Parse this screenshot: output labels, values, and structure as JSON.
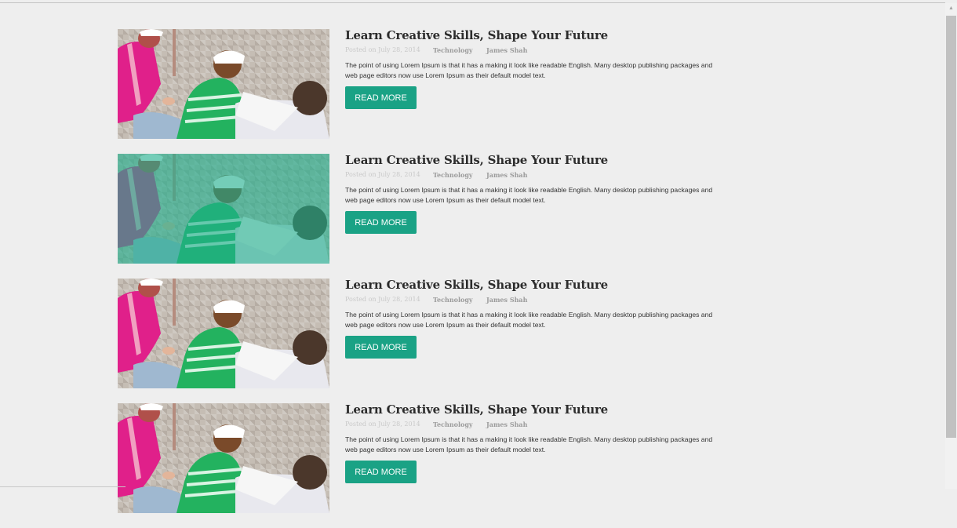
{
  "posts": [
    {
      "title": "Learn Creative Skills, Shape Your Future",
      "posted": "Posted on July 28, 2014",
      "category": "Technology",
      "author": "James Shah",
      "excerpt": "The point of using Lorem Ipsum is that it has a making it look like readable English. Many desktop publishing packages and web page editors now use Lorem Ipsum as their default model text.",
      "button": "READ MORE",
      "highlighted": false
    },
    {
      "title": "Learn Creative Skills, Shape Your Future",
      "posted": "Posted on July 28, 2014",
      "category": "Technology",
      "author": "James Shah",
      "excerpt": "The point of using Lorem Ipsum is that it has a making it look like readable English. Many desktop publishing packages and web page editors now use Lorem Ipsum as their default model text.",
      "button": "READ MORE",
      "highlighted": true
    },
    {
      "title": "Learn Creative Skills, Shape Your Future",
      "posted": "Posted on July 28, 2014",
      "category": "Technology",
      "author": "James Shah",
      "excerpt": "The point of using Lorem Ipsum is that it has a making it look like readable English. Many desktop publishing packages and web page editors now use Lorem Ipsum as their default model text.",
      "button": "READ MORE",
      "highlighted": false
    },
    {
      "title": "Learn Creative Skills, Shape Your Future",
      "posted": "Posted on July 28, 2014",
      "category": "Technology",
      "author": "James Shah",
      "excerpt": "The point of using Lorem Ipsum is that it has a making it look like readable English. Many desktop publishing packages and web page editors now use Lorem Ipsum as their default model text.",
      "button": "READ MORE",
      "highlighted": false
    }
  ],
  "colors": {
    "accent": "#1aa285",
    "overlay": "#1fae8c",
    "background": "#eeeeee"
  },
  "thumbnail_icon": "students-photo"
}
